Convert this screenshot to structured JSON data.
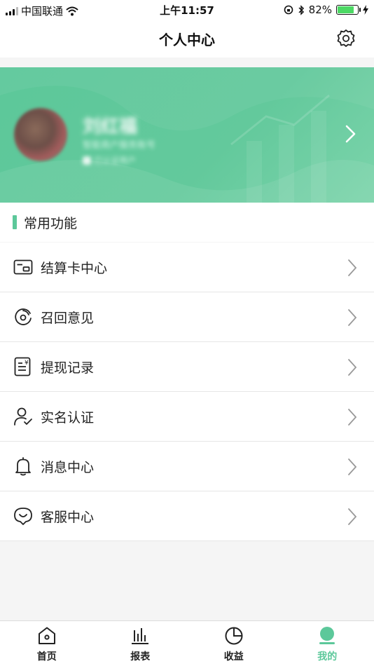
{
  "status_bar": {
    "carrier": "中国联通",
    "time": "上午11:57",
    "battery_percent": "82%",
    "battery_level": 0.82
  },
  "header": {
    "title": "个人中心",
    "settings_icon": "gear-icon"
  },
  "section": {
    "title": "常用功能",
    "accent_color": "#5cc89a"
  },
  "menu": {
    "items": [
      {
        "label": "结算卡中心",
        "icon": "card-icon"
      },
      {
        "label": "召回意见",
        "icon": "feedback-icon"
      },
      {
        "label": "提现记录",
        "icon": "withdraw-record-icon"
      },
      {
        "label": "实名认证",
        "icon": "user-verify-icon"
      },
      {
        "label": "消息中心",
        "icon": "bell-icon"
      },
      {
        "label": "客服中心",
        "icon": "customer-service-icon"
      }
    ]
  },
  "tabs": [
    {
      "label": "首页",
      "icon": "home-icon",
      "active": false
    },
    {
      "label": "报表",
      "icon": "bar-chart-icon",
      "active": false
    },
    {
      "label": "收益",
      "icon": "pie-chart-icon",
      "active": false
    },
    {
      "label": "我的",
      "icon": "profile-icon",
      "active": true
    }
  ],
  "colors": {
    "brand": "#5cc89a",
    "text": "#222222",
    "background": "#f5f5f5"
  }
}
